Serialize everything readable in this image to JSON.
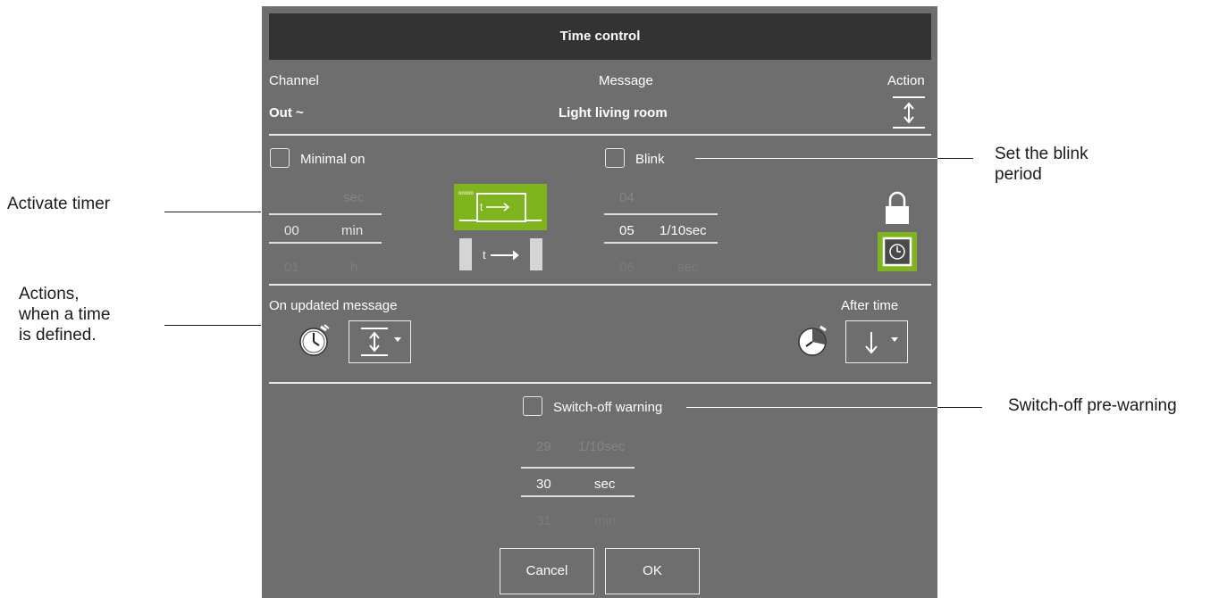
{
  "dialog": {
    "title": "Time control",
    "header": {
      "channel_label": "Channel",
      "message_label": "Message",
      "action_label": "Action",
      "channel_value": "Out ~",
      "message_value": "Light living room",
      "action_icon": "up-down-arrow-icon"
    },
    "timer": {
      "minimal_on_label": "Minimal on",
      "minimal_on_checked": false,
      "picker": [
        {
          "value": "",
          "unit": "sec"
        },
        {
          "value": "00",
          "unit": "min"
        },
        {
          "value": "01",
          "unit": "h"
        }
      ],
      "mode_icons": [
        "timer-mode-stretch-icon",
        "timer-mode-fixed-icon"
      ]
    },
    "blink": {
      "label": "Blink",
      "checked": false,
      "picker": [
        {
          "value": "04",
          "unit": ""
        },
        {
          "value": "05",
          "unit": "1/10sec"
        },
        {
          "value": "06",
          "unit": "sec"
        }
      ],
      "lock_icon": "lock-icon",
      "clock_icon": "clock-icon"
    },
    "actions": {
      "on_updated_label": "On updated message",
      "on_updated_value_icon": "up-down-arrow-icon",
      "after_time_label": "After time",
      "after_time_value_icon": "down-arrow-icon"
    },
    "warning": {
      "label": "Switch-off warning",
      "checked": false,
      "picker": [
        {
          "value": "29",
          "unit": "1/10sec"
        },
        {
          "value": "30",
          "unit": "sec"
        },
        {
          "value": "31",
          "unit": "min"
        }
      ]
    },
    "buttons": {
      "cancel": "Cancel",
      "ok": "OK"
    }
  },
  "callouts": {
    "activate_timer": "Activate timer",
    "actions_line1": "Actions,",
    "actions_line2": "when a time",
    "actions_line3": "is defined.",
    "blink_line1": "Set the blink",
    "blink_line2": "period",
    "prewarning": "Switch-off pre-warning"
  },
  "colors": {
    "accent_green": "#7fb51c",
    "dialog_bg": "#6e6e6e",
    "titlebar_bg": "#333333"
  }
}
